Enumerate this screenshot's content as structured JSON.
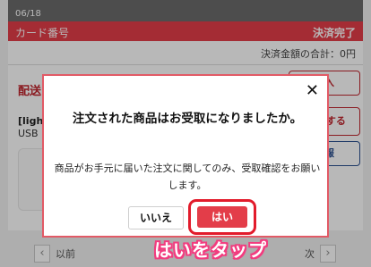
{
  "header": {
    "date": "06/18",
    "card_label": "カード番号",
    "status": "決済完了",
    "total_label": "決済金額の合計：0円"
  },
  "order": {
    "section_title": "配送",
    "product_name": "[light",
    "product_sub": "USB",
    "buttons": [
      "購入",
      "一を\nする",
      "情報"
    ]
  },
  "pager": {
    "prev_icon": "‹",
    "prev_label": "以前",
    "next_label": "次",
    "next_icon": "›"
  },
  "modal": {
    "close_icon": "✕",
    "title": "注文された商品はお受取になりましたか。",
    "body": "商品がお手元に届いた注文に関してのみ、受取確認をお願いします。",
    "no_label": "いいえ",
    "yes_label": "はい"
  },
  "annotation": "はいをタップ",
  "colors": {
    "accent": "#e33d49",
    "header_bg": "#6b6b6b",
    "highlight": "#e21b2b",
    "annotation_outline": "#f23c7f"
  }
}
